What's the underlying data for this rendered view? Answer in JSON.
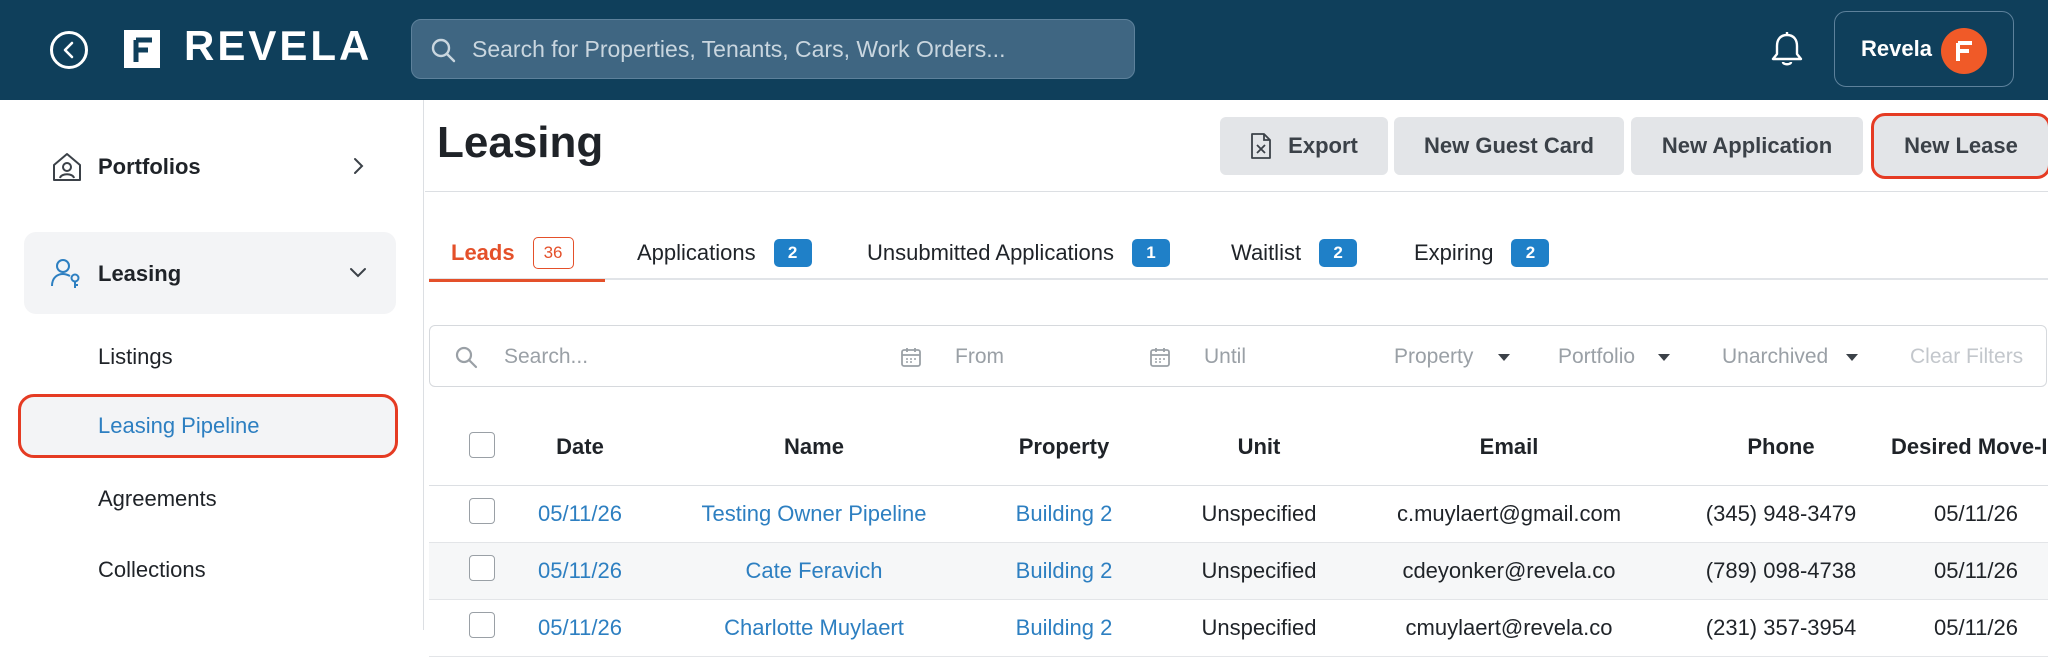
{
  "topbar": {
    "brand": "REVELA",
    "search_placeholder": "Search for Properties, Tenants, Cars, Work Orders...",
    "user_name": "Revela"
  },
  "sidebar": {
    "portfolios": "Portfolios",
    "leasing": "Leasing",
    "sub_items": [
      "Listings",
      "Leasing Pipeline",
      "Agreements",
      "Collections"
    ]
  },
  "header": {
    "title": "Leasing",
    "export": "Export",
    "new_guest_card": "New Guest Card",
    "new_application": "New Application",
    "new_lease": "New Lease"
  },
  "tabs": [
    {
      "label": "Leads",
      "count": "36"
    },
    {
      "label": "Applications",
      "count": "2"
    },
    {
      "label": "Unsubmitted Applications",
      "count": "1"
    },
    {
      "label": "Waitlist",
      "count": "2"
    },
    {
      "label": "Expiring",
      "count": "2"
    }
  ],
  "filters": {
    "search_placeholder": "Search...",
    "from": "From",
    "until": "Until",
    "property": "Property",
    "portfolio": "Portfolio",
    "archived": "Unarchived",
    "clear": "Clear Filters"
  },
  "table": {
    "headers": [
      "Date",
      "Name",
      "Property",
      "Unit",
      "Email",
      "Phone",
      "Desired Move-In"
    ],
    "rows": [
      [
        "05/11/26",
        "Testing Owner Pipeline",
        "Building 2",
        "Unspecified",
        "c.muylaert@gmail.com",
        "(345) 948-3479",
        "05/11/26"
      ],
      [
        "05/11/26",
        "Cate Feravich",
        "Building 2",
        "Unspecified",
        "cdeyonker@revela.co",
        "(789) 098-4738",
        "05/11/26"
      ],
      [
        "05/11/26",
        "Charlotte Muylaert",
        "Building 2",
        "Unspecified",
        "cmuylaert@revela.co",
        "(231) 357-3954",
        "05/11/26"
      ]
    ]
  },
  "colors": {
    "topbar": "#0f3f5b",
    "accent_orange": "#e4502a",
    "highlight_red": "#e53b23",
    "link_blue": "#2d7fc1",
    "badge_blue": "#1f80c8"
  }
}
